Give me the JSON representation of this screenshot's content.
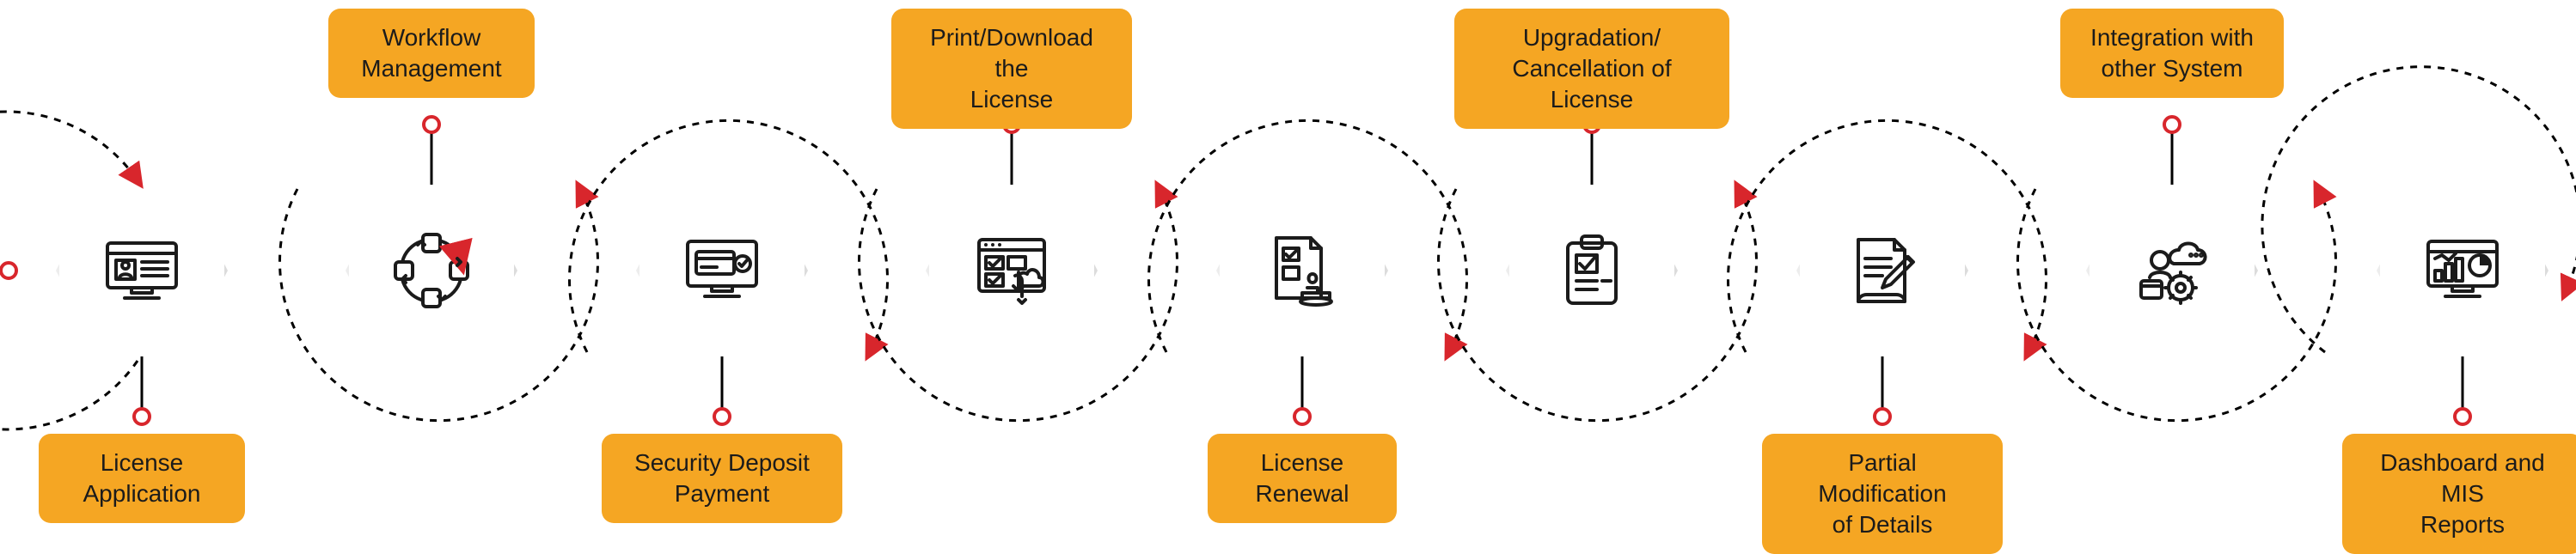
{
  "colors": {
    "accent": "#f5a623",
    "marker": "#d8262c",
    "stroke": "#1b1b1b",
    "hex_border": "#dcdcdc"
  },
  "steps": [
    {
      "label": "License\nApplication",
      "position": "bottom",
      "icon": "application-form-monitor-icon"
    },
    {
      "label": "Workflow\nManagement",
      "position": "top",
      "icon": "workflow-cycle-icon"
    },
    {
      "label": "Security Deposit\nPayment",
      "position": "bottom",
      "icon": "online-payment-monitor-icon"
    },
    {
      "label": "Print/Download the\nLicense",
      "position": "top",
      "icon": "select-download-screen-icon"
    },
    {
      "label": "License\nRenewal",
      "position": "bottom",
      "icon": "document-stamp-icon"
    },
    {
      "label": "Upgradation/\nCancellation of License",
      "position": "top",
      "icon": "clipboard-check-icon"
    },
    {
      "label": "Partial Modification\nof Details",
      "position": "bottom",
      "icon": "edit-document-pencil-icon"
    },
    {
      "label": "Integration with\nother System",
      "position": "top",
      "icon": "integration-cloud-gear-icon"
    },
    {
      "label": "Dashboard and MIS\nReports",
      "position": "bottom",
      "icon": "dashboard-analytics-monitor-icon"
    }
  ]
}
